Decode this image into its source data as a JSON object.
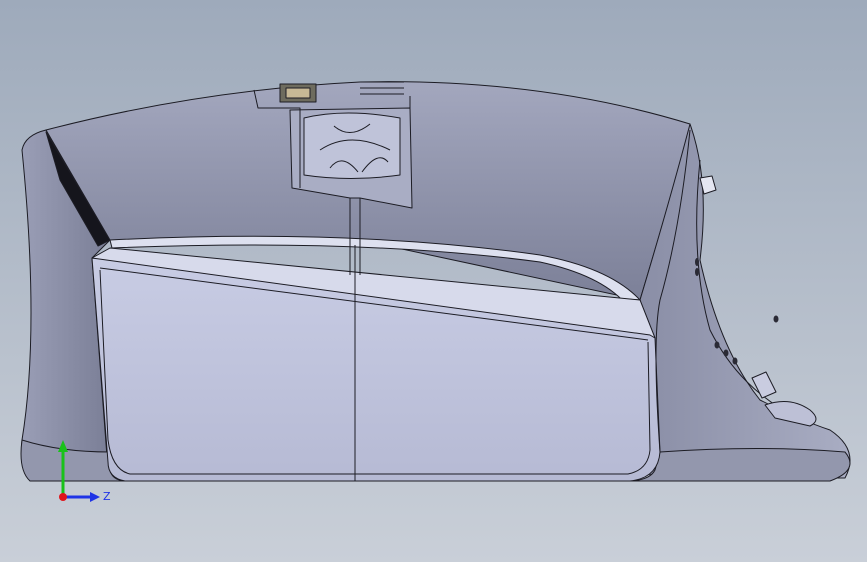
{
  "viewport": {
    "background_top": "#9eaabb",
    "background_bottom": "#c9cfd8"
  },
  "model": {
    "body_color": "#8d91a8",
    "body_light": "#b6bad1",
    "front_panel_color": "#c4c8e2",
    "edge_color": "#1c1c24"
  },
  "triad": {
    "y_color": "#19c219",
    "z_color": "#1f33e6",
    "origin_color": "#e0151b",
    "z_label": "Z"
  }
}
